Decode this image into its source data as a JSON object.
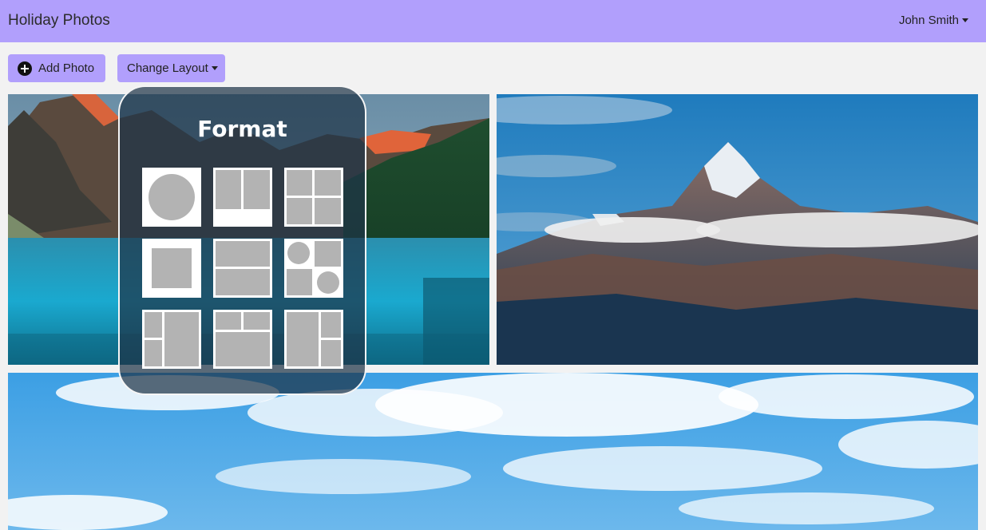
{
  "navbar": {
    "title": "Holiday Photos",
    "user_name": "John Smith"
  },
  "toolbar": {
    "add_photo_label": "Add Photo",
    "change_layout_label": "Change Layout"
  },
  "layout_popup": {
    "title": "Format",
    "options": [
      "single-circle",
      "two-column-split",
      "four-grid",
      "single-square",
      "two-row-split",
      "circles-and-squares",
      "left-stack-right-tall",
      "top-split-bottom-wide",
      "left-tall-right-stack"
    ]
  },
  "photos": [
    {
      "subject": "mountain lake with forest"
    },
    {
      "subject": "snowy mountain peak above clouds"
    },
    {
      "subject": "blue sky with clouds"
    }
  ],
  "colors": {
    "accent": "#b19ffc",
    "background": "#f2f2f2",
    "option_fill": "#b3b3b3"
  }
}
